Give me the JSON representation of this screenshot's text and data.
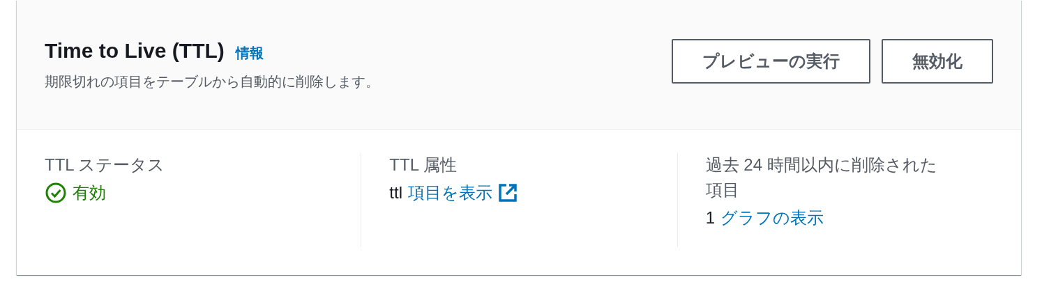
{
  "header": {
    "title": "Time to Live (TTL)",
    "info_link": "情報",
    "description": "期限切れの項目をテーブルから自動的に削除します。",
    "buttons": [
      "プレビューの実行",
      "無効化"
    ]
  },
  "columns": [
    {
      "kind": "status",
      "label": "TTL ステータス",
      "value": "有効",
      "enabled": true
    },
    {
      "kind": "link",
      "label": "TTL 属性",
      "value": "ttl",
      "link": "項目を表示",
      "external": true
    },
    {
      "kind": "link",
      "label": "過去 24 時間以内に削除された項目",
      "value": "1",
      "link": "グラフの表示",
      "external": false
    }
  ]
}
